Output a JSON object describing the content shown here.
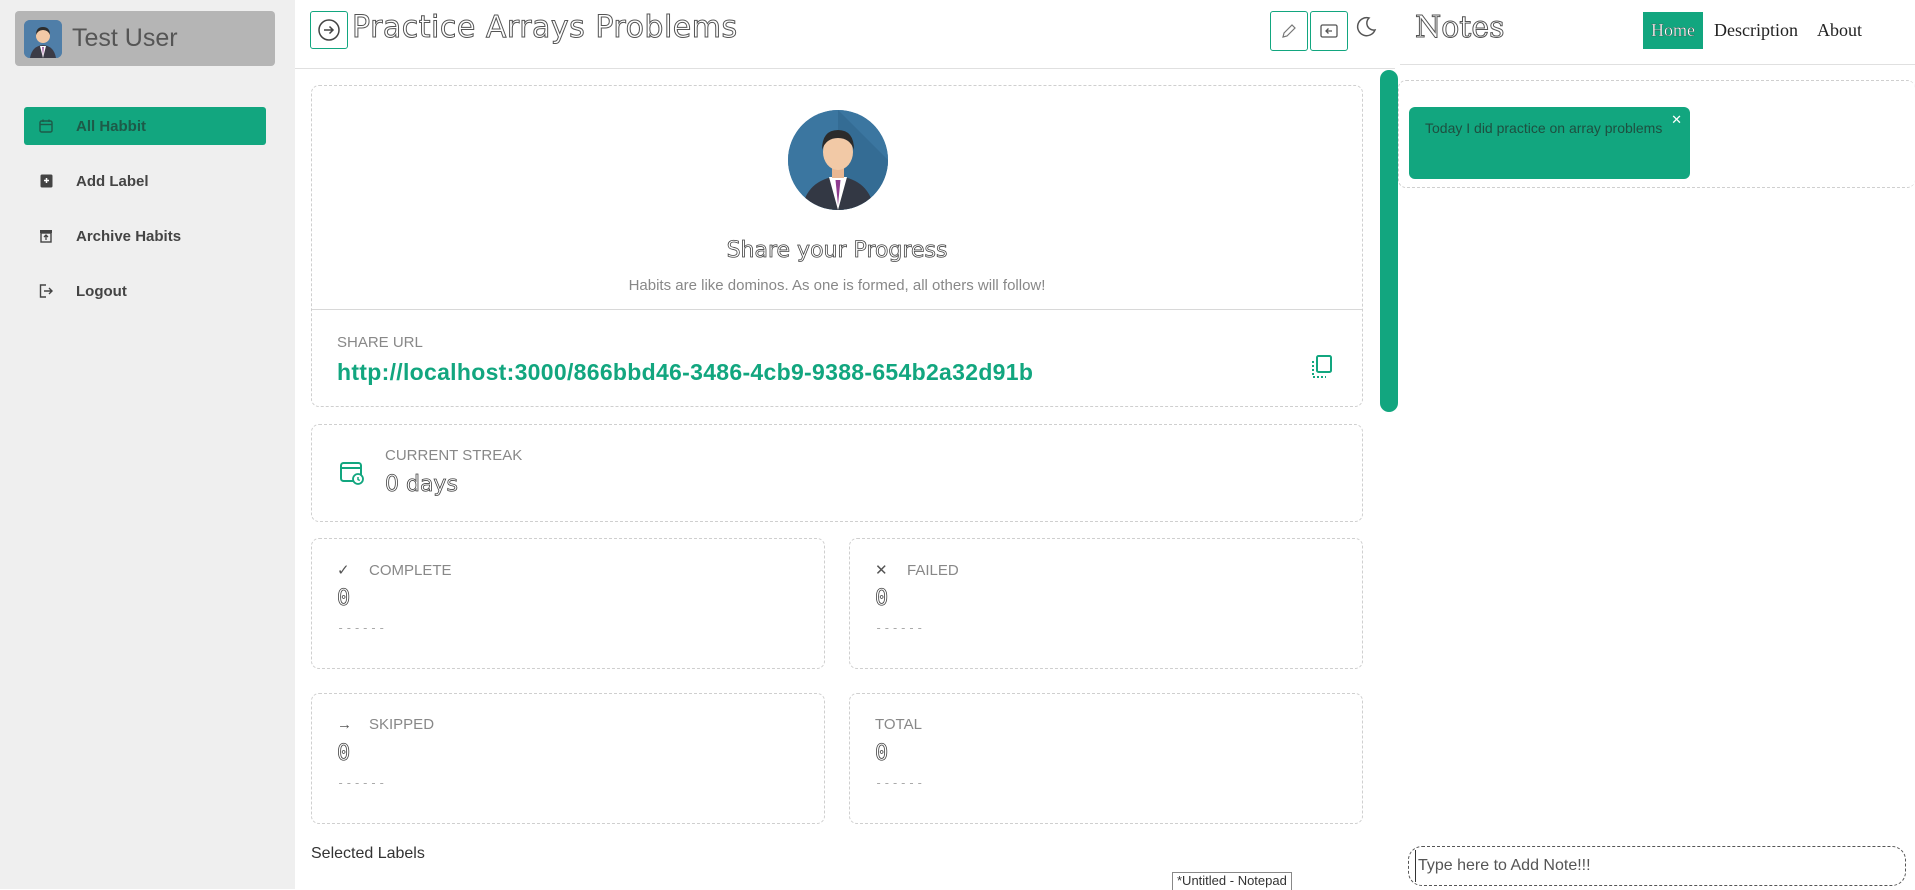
{
  "user": {
    "name": "Test User"
  },
  "sidebar": {
    "items": [
      {
        "label": "All Habbit",
        "icon": "calendar-icon",
        "active": true
      },
      {
        "label": "Add Label",
        "icon": "label-add-icon",
        "active": false
      },
      {
        "label": "Archive Habits",
        "icon": "archive-icon",
        "active": false
      },
      {
        "label": "Logout",
        "icon": "logout-icon",
        "active": false
      }
    ]
  },
  "header": {
    "title": "Practice Arrays Problems"
  },
  "profile": {
    "share_title": "Share your Progress",
    "share_subtitle": "Habits are like dominos. As one is formed, all others will follow!",
    "share_url_label": "SHARE URL",
    "share_url": "http://localhost:3000/866bbd46-3486-4cb9-9388-654b2a32d91b"
  },
  "streak": {
    "label": "CURRENT STREAK",
    "value": "0 days"
  },
  "stats": [
    {
      "label": "COMPLETE",
      "value": "0",
      "dashes": "------",
      "symbol": "✓"
    },
    {
      "label": "FAILED",
      "value": "0",
      "dashes": "------",
      "symbol": "✕"
    },
    {
      "label": "SKIPPED",
      "value": "0",
      "dashes": "------",
      "symbol": "→"
    },
    {
      "label": "TOTAL",
      "value": "0",
      "dashes": "------",
      "symbol": ""
    }
  ],
  "selected_labels": "Selected Labels",
  "taskbar_hint": "*Untitled - Notepad",
  "notes": {
    "title": "Notes",
    "nav": [
      "Home",
      "Description",
      "About"
    ],
    "items": [
      {
        "text": "Today I did practice on array problems"
      }
    ],
    "input_placeholder": "Type here to Add Note!!!"
  },
  "colors": {
    "accent": "#12a67f",
    "sidebar_bg": "#efefef"
  }
}
